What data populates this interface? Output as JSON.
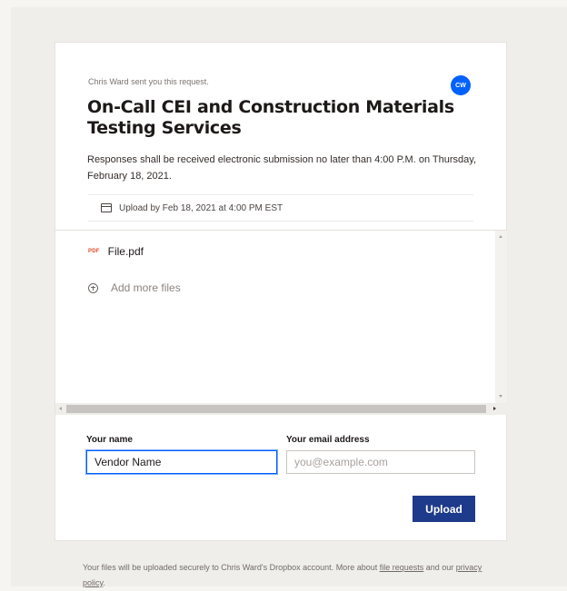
{
  "request": {
    "sender_text": "Chris Ward sent you this request.",
    "avatar_initials": "CW",
    "title": "On-Call CEI and Construction Materials Testing Services",
    "description": "Responses shall be received electronic submission  no later than 4:00 P.M. on Thursday, February 18, 2021.",
    "deadline_text": "Upload by Feb 18, 2021 at 4:00 PM EST"
  },
  "files": {
    "items": [
      {
        "type_badge": "PDF",
        "name": "File.pdf"
      }
    ],
    "add_more_label": "Add more files"
  },
  "form": {
    "name_label": "Your name",
    "name_value": "Vendor Name",
    "email_label": "Your email address",
    "email_placeholder": "you@example.com",
    "upload_label": "Upload"
  },
  "footer": {
    "text_before_link": "Your files will be uploaded securely to Chris Ward's Dropbox account. More about ",
    "link1_text": "file requests",
    "text_between": " and our ",
    "link2_text": "privacy policy",
    "text_after": "."
  },
  "colors": {
    "accent": "#0061fe",
    "upload_button": "#1e3a8a",
    "pdf_badge": "#e8492b"
  }
}
